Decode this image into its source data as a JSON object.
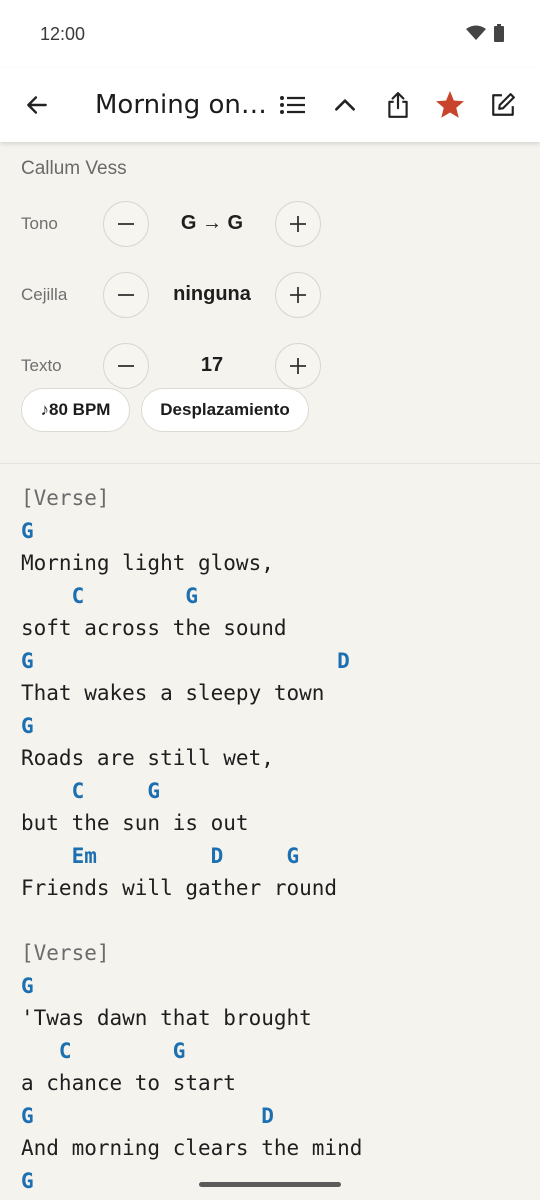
{
  "status": {
    "time": "12:00"
  },
  "header": {
    "title": "Morning on t…"
  },
  "song": {
    "artist": "Callum Vess"
  },
  "controls": {
    "key": {
      "label": "Tono",
      "value": "G → G"
    },
    "capo": {
      "label": "Cejilla",
      "value": "ninguna"
    },
    "text_size": {
      "label": "Texto",
      "value": "17"
    }
  },
  "chips": {
    "bpm": "♪80 BPM",
    "scroll": "Desplazamiento"
  },
  "colors": {
    "chord": "#1c6fb0",
    "favorite": "#c8442a",
    "background": "#f5f3ee"
  },
  "sheet": [
    {
      "type": "section",
      "text": "[Verse]"
    },
    {
      "type": "chords",
      "text": "G"
    },
    {
      "type": "lyric",
      "text": "Morning light glows,"
    },
    {
      "type": "chords",
      "text": "    C        G"
    },
    {
      "type": "lyric",
      "text": "soft across the sound"
    },
    {
      "type": "chords",
      "text": "G                        D"
    },
    {
      "type": "lyric",
      "text": "That wakes a sleepy town"
    },
    {
      "type": "chords",
      "text": "G"
    },
    {
      "type": "lyric",
      "text": "Roads are still wet,"
    },
    {
      "type": "chords",
      "text": "    C     G"
    },
    {
      "type": "lyric",
      "text": "but the sun is out"
    },
    {
      "type": "chords",
      "text": "    Em         D     G"
    },
    {
      "type": "lyric",
      "text": "Friends will gather round"
    },
    {
      "type": "blank",
      "text": ""
    },
    {
      "type": "section",
      "text": "[Verse]"
    },
    {
      "type": "chords",
      "text": "G"
    },
    {
      "type": "lyric",
      "text": "'Twas dawn that brought"
    },
    {
      "type": "chords",
      "text": "   C        G"
    },
    {
      "type": "lyric",
      "text": "a chance to start"
    },
    {
      "type": "chords",
      "text": "G                  D"
    },
    {
      "type": "lyric",
      "text": "And morning clears the mind"
    },
    {
      "type": "chords",
      "text": "G"
    }
  ]
}
